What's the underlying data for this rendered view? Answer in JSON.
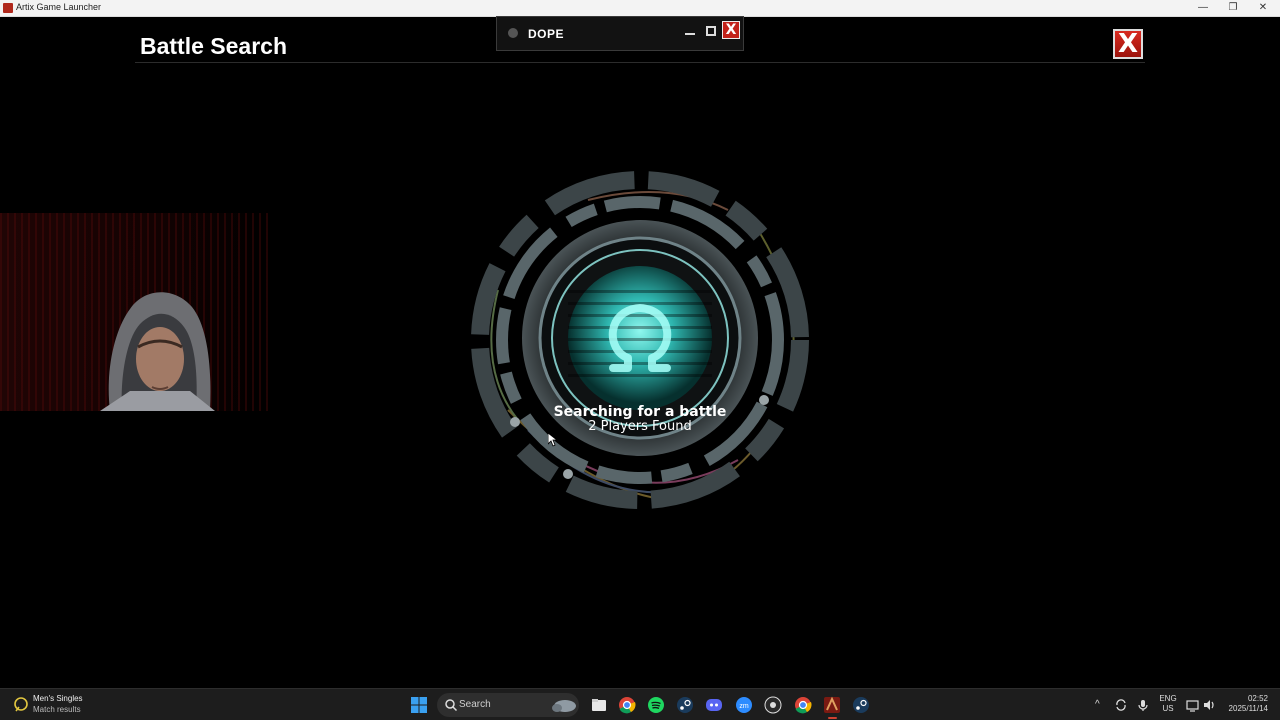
{
  "window": {
    "title": "Artix Game Launcher",
    "controls": {
      "minimize": "—",
      "maximize": "❐",
      "close": "✕"
    }
  },
  "game": {
    "title": "Battle Search",
    "close_label": "X",
    "overlay": {
      "label": "DOPE",
      "close_label": "X"
    },
    "status_title": "Searching for a battle",
    "status_sub": "2 Players Found"
  },
  "taskbar": {
    "widget": {
      "title": "Men's Singles",
      "subtitle": "Match results"
    },
    "search_placeholder": "Search",
    "pinned_icons": [
      "file-explorer-icon",
      "chrome-icon",
      "spotify-icon",
      "steam-icon",
      "discord-icon",
      "zoom-icon",
      "obs-icon",
      "chrome-alt-icon",
      "artix-launcher-icon",
      "steam-alt-icon"
    ],
    "tray": {
      "lang_line1": "ENG",
      "lang_line2": "US",
      "time": "02:52",
      "date": "2025/11/14"
    }
  },
  "colors": {
    "accent_cyan": "#3fd6d0",
    "close_red": "#c2221a",
    "taskbar": "#1d1d1d"
  }
}
